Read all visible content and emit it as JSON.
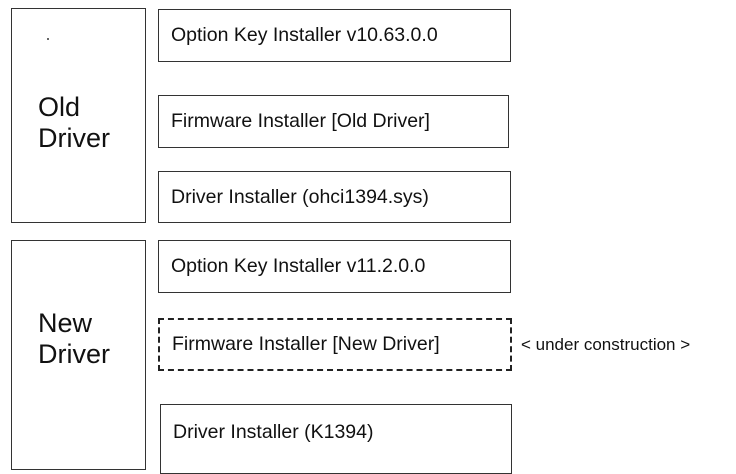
{
  "groups": {
    "old": {
      "label": "Old\nDriver",
      "items": [
        {
          "label": "Option Key Installer v10.63.0.0"
        },
        {
          "label": "Firmware Installer [Old Driver]"
        },
        {
          "label": "Driver Installer (ohci1394.sys)"
        }
      ]
    },
    "new": {
      "label": "New\nDriver",
      "items": [
        {
          "label": "Option Key Installer v11.2.0.0"
        },
        {
          "label": "Firmware Installer [New Driver]",
          "status_note": "< under construction >"
        },
        {
          "label": "Driver Installer (K1394)"
        }
      ]
    }
  }
}
